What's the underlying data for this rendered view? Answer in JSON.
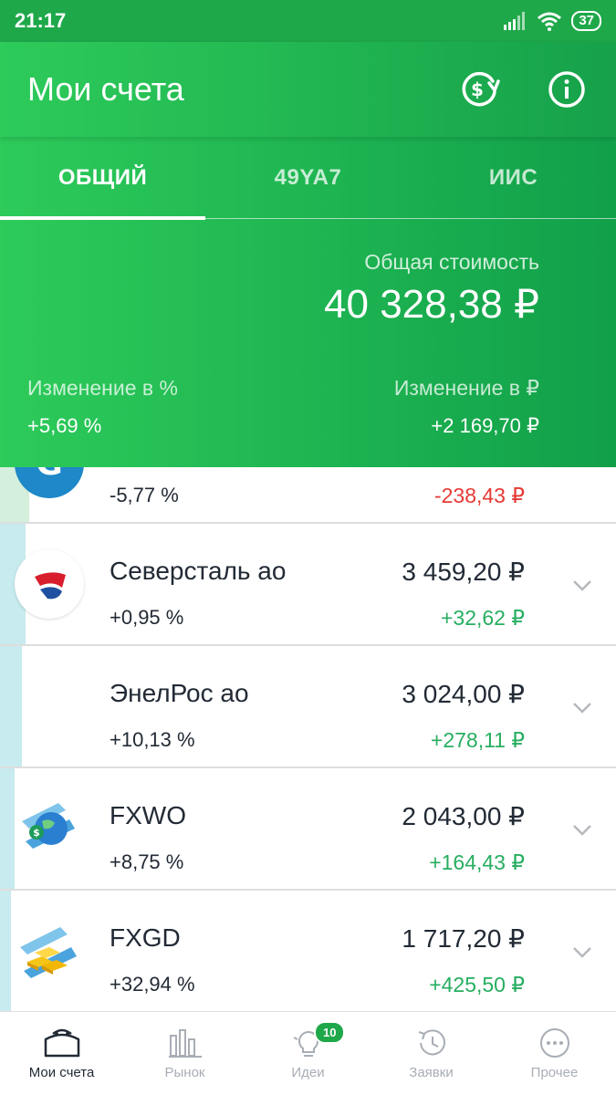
{
  "status_bar": {
    "time": "21:17",
    "battery": "37"
  },
  "header": {
    "title": "Мои счета",
    "exchange_icon": "currency-exchange-icon",
    "info_icon": "info-icon"
  },
  "tabs": [
    {
      "label": "ОБЩИЙ",
      "active": true
    },
    {
      "label": "49YA7",
      "active": false
    },
    {
      "label": "ИИС",
      "active": false
    }
  ],
  "summary": {
    "total_label": "Общая стоимость",
    "total_value": "40 328,38 ₽",
    "change_pct_label": "Изменение в  %",
    "change_pct_value": "+5,69  %",
    "change_rub_label": "Изменение в ₽",
    "change_rub_value": "+2 169,70 ₽"
  },
  "positions": [
    {
      "name": "",
      "pct": "-5,77  %",
      "price": "",
      "delta": "-238,43 ₽",
      "trend": "negative",
      "logo": "g-logo-icon",
      "stripe_color": "#d4efdc"
    },
    {
      "name": "Северсталь ао",
      "pct": "+0,95  %",
      "price": "3 459,20 ₽",
      "delta": "+32,62 ₽",
      "trend": "positive",
      "logo": "severstal-logo-icon",
      "stripe_color": "#c7ebee"
    },
    {
      "name": "ЭнелРос ао",
      "pct": "+10,13  %",
      "price": "3 024,00 ₽",
      "delta": "+278,11 ₽",
      "trend": "positive",
      "logo": "",
      "stripe_color": "#c7ebee"
    },
    {
      "name": "FXWO",
      "pct": "+8,75  %",
      "price": "2 043,00 ₽",
      "delta": "+164,43 ₽",
      "trend": "positive",
      "logo": "globe-dollar-icon",
      "stripe_color": "#c7ebee"
    },
    {
      "name": "FXGD",
      "pct": "+32,94  %",
      "price": "1 717,20 ₽",
      "delta": "+425,50 ₽",
      "trend": "positive",
      "logo": "gold-bars-icon",
      "stripe_color": "#c7ebee"
    }
  ],
  "bottom_nav": [
    {
      "label": "Мои счета",
      "icon": "wallet-icon",
      "active": true
    },
    {
      "label": "Рынок",
      "icon": "market-chart-icon",
      "active": false
    },
    {
      "label": "Идеи",
      "icon": "lightbulb-icon",
      "active": false,
      "badge": "10"
    },
    {
      "label": "Заявки",
      "icon": "history-clock-icon",
      "active": false
    },
    {
      "label": "Прочее",
      "icon": "more-dots-icon",
      "active": false
    }
  ],
  "colors": {
    "brand_green": "#1fa84a",
    "positive": "#27ae60",
    "negative": "#e53935",
    "text_dark": "#222a35"
  }
}
